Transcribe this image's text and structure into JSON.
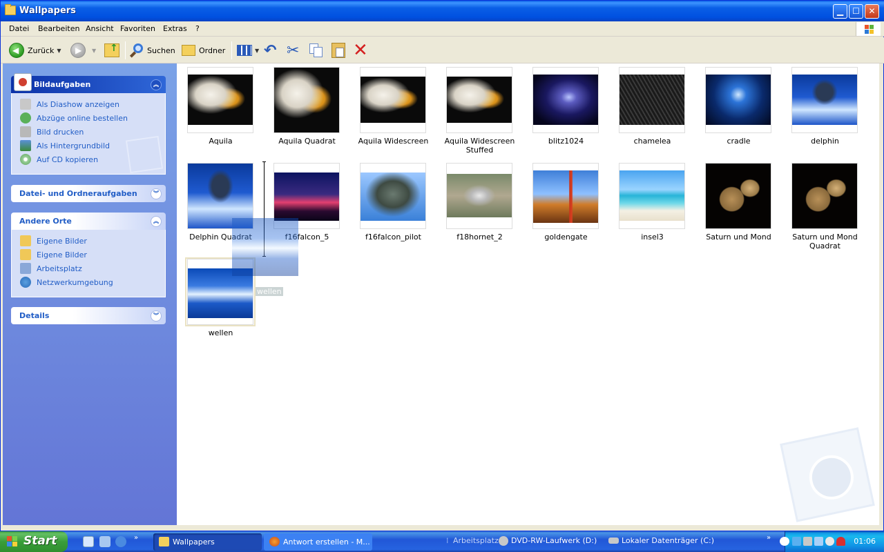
{
  "window": {
    "title": "Wallpapers"
  },
  "menu": [
    "Datei",
    "Bearbeiten",
    "Ansicht",
    "Favoriten",
    "Extras",
    "?"
  ],
  "toolbar": {
    "back_label": "Zurück",
    "search_label": "Suchen",
    "folders_label": "Ordner"
  },
  "sidebar": {
    "picture_tasks": {
      "title": "Bildaufgaben",
      "links": [
        "Als Diashow anzeigen",
        "Abzüge online bestellen",
        "Bild drucken",
        "Als Hintergrundbild",
        "Auf CD kopieren"
      ]
    },
    "file_tasks": {
      "title": "Datei- und Ordneraufgaben"
    },
    "other_places": {
      "title": "Andere Orte",
      "links": [
        "Eigene Bilder",
        "Eigene Bilder",
        "Arbeitsplatz",
        "Netzwerkumgebung"
      ]
    },
    "details": {
      "title": "Details"
    }
  },
  "files": [
    {
      "name": "Aquila",
      "style": "eagle"
    },
    {
      "name": "Aquila Quadrat",
      "style": "eagle"
    },
    {
      "name": "Aquila Widescreen",
      "style": "eagle"
    },
    {
      "name": "Aquila Widescreen Stuffed",
      "style": "eagle"
    },
    {
      "name": "blitz1024",
      "style": "lightning"
    },
    {
      "name": "chamelea",
      "style": "chamelea"
    },
    {
      "name": "cradle",
      "style": "cradle"
    },
    {
      "name": "delphin",
      "style": "dolphin"
    },
    {
      "name": "Delphin Quadrat",
      "style": "dolphin"
    },
    {
      "name": "f16falcon_5",
      "style": "falcon"
    },
    {
      "name": "f16falcon_pilot",
      "style": "pilot"
    },
    {
      "name": "f18hornet_2",
      "style": "hornet"
    },
    {
      "name": "goldengate",
      "style": "goldengate"
    },
    {
      "name": "insel3",
      "style": "insel"
    },
    {
      "name": "Saturn und Mond",
      "style": "saturn"
    },
    {
      "name": "Saturn und Mond Quadrat",
      "style": "saturn"
    },
    {
      "name": "wellen",
      "style": "wellen"
    }
  ],
  "drag_ghost_label": "wellen",
  "taskbar": {
    "start_label": "Start",
    "buttons": [
      "Wallpapers",
      "Antwort erstellen - M..."
    ],
    "bands": [
      "Arbeitsplatz",
      "DVD-RW-Laufwerk (D:)",
      "Lokaler Datenträger (C:)"
    ],
    "clock": "01:06"
  }
}
